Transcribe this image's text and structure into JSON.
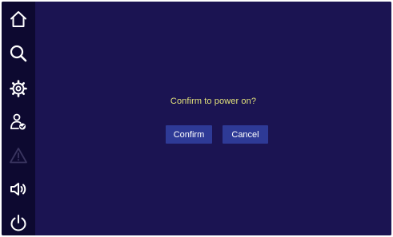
{
  "sidebar": {
    "items": [
      {
        "icon": "home-icon",
        "color": "#ffffff"
      },
      {
        "icon": "search-icon",
        "color": "#ffffff"
      },
      {
        "icon": "gear-icon",
        "color": "#ffffff"
      },
      {
        "icon": "user-check-icon",
        "color": "#ffffff"
      },
      {
        "icon": "warning-icon",
        "color": "#3a3560"
      },
      {
        "icon": "speaker-icon",
        "color": "#ffffff"
      },
      {
        "icon": "power-icon",
        "color": "#ffffff"
      }
    ]
  },
  "dialog": {
    "message": "Confirm to power on?",
    "confirm_label": "Confirm",
    "cancel_label": "Cancel"
  },
  "colors": {
    "background": "#1b1452",
    "sidebar": "#0d0930",
    "button": "#2e3a96",
    "message_text": "#e2e17a"
  }
}
